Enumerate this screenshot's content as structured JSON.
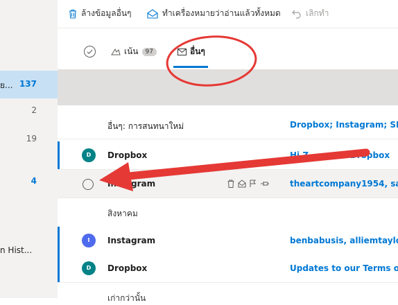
{
  "folders": [
    {
      "label": "ย...",
      "count": "137",
      "selected": true
    },
    {
      "label": "",
      "count": "2"
    },
    {
      "label": "",
      "count": "19"
    },
    {
      "label": "",
      "count": ""
    },
    {
      "label": "",
      "count": "4"
    },
    {
      "label": "",
      "count": ""
    },
    {
      "label": "n Hist...",
      "count": ""
    }
  ],
  "toolbar": {
    "clear_label": "ล้างข้อมูลอื่นๆ",
    "mark_read_label": "ทำเครื่องหมายว่าอ่านแล้วทั้งหมด",
    "undo_label": "เลิกทำ"
  },
  "tabs": {
    "focused_label": "เน้น",
    "focused_count": "97",
    "other_label": "อื่นๆ"
  },
  "summary_row": {
    "label": "อื่นๆ: การสนทนาใหม่",
    "senders": "Dropbox; Instagram; SE"
  },
  "messages_top": [
    {
      "sender": "Dropbox",
      "avatar": "D",
      "avatar_color": "#038387",
      "subject": "Hi Z      your Dropbox",
      "unread": true
    },
    {
      "sender": "Instagram",
      "avatar": "",
      "subject": "theartcompany1954, sa",
      "unread": false,
      "hover": true
    }
  ],
  "group_header": "สิงหาคม",
  "messages_bottom": [
    {
      "sender": "Instagram",
      "avatar": "I",
      "avatar_color": "#4f6bed",
      "subject": "benbabusis, alliemtaylo",
      "unread": true
    },
    {
      "sender": "Dropbox",
      "avatar": "D",
      "avatar_color": "#038387",
      "subject": "Updates to our Terms o",
      "unread": true
    }
  ],
  "next_group_header": "เก่ากว่านั้น",
  "colors": {
    "accent": "#0078d4",
    "annotation": "#e53935"
  }
}
